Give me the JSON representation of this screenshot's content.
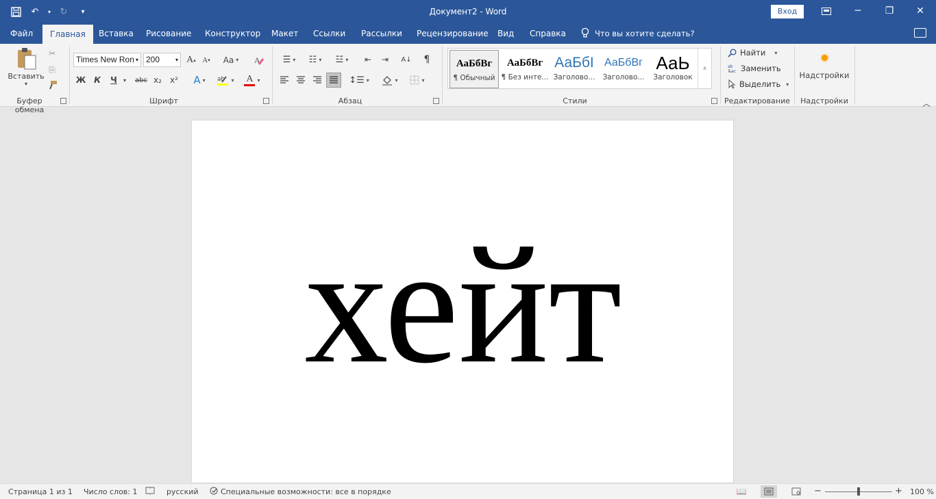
{
  "window": {
    "title": "Документ2  -  Word",
    "signin": "Вход",
    "minimize": "─",
    "restore": "❐",
    "close": "✕"
  },
  "qat": {
    "save": "💾",
    "undo": "↶",
    "redo": "↻",
    "customize": "▾"
  },
  "tabs": [
    {
      "label": "Файл"
    },
    {
      "label": "Главная"
    },
    {
      "label": "Вставка"
    },
    {
      "label": "Рисование"
    },
    {
      "label": "Конструктор"
    },
    {
      "label": "Макет"
    },
    {
      "label": "Ссылки"
    },
    {
      "label": "Рассылки"
    },
    {
      "label": "Рецензирование"
    },
    {
      "label": "Вид"
    },
    {
      "label": "Справка"
    }
  ],
  "active_tab": "Главная",
  "tell_me": "Что вы хотите сделать?",
  "ribbon": {
    "clipboard": {
      "paste": "Вставить",
      "label": "Буфер обмена"
    },
    "font": {
      "name": "Times New Ron",
      "size": "200",
      "label": "Шрифт",
      "grow": "A",
      "shrink": "A",
      "case": "Aa",
      "bold": "Ж",
      "italic": "К",
      "underline": "Ч",
      "strike": "abc",
      "sub": "x₂",
      "sup": "x²",
      "effects": "A",
      "color_letter": "A",
      "font_color": "#e00000",
      "highlight_color": "#ffff00"
    },
    "paragraph": {
      "label": "Абзац",
      "pilcrow": "¶"
    },
    "styles": {
      "label": "Стили",
      "items": [
        {
          "sample": "АаБбВг",
          "name": "¶ Обычный"
        },
        {
          "sample": "АаБбВг",
          "name": "¶ Без инте..."
        },
        {
          "sample": "АаБбI",
          "name": "Заголово..."
        },
        {
          "sample": "АаБбВг",
          "name": "Заголово..."
        },
        {
          "sample": "АаЬ",
          "name": "Заголовок"
        }
      ],
      "heading_color": "#2e74b5"
    },
    "editing": {
      "label": "Редактирование",
      "find": "Найти",
      "replace": "Заменить",
      "select": "Выделить"
    },
    "addins": {
      "label": "Надстройки",
      "button": "Надстройки",
      "dot_color": "#f5a000"
    }
  },
  "document": {
    "text": "хейт"
  },
  "status": {
    "page": "Страница 1 из 1",
    "words": "Число слов: 1",
    "language": "русский",
    "accessibility": "Специальные возможности: все в порядке",
    "zoom": "100 %",
    "zoom_minus": "−",
    "zoom_plus": "+"
  }
}
